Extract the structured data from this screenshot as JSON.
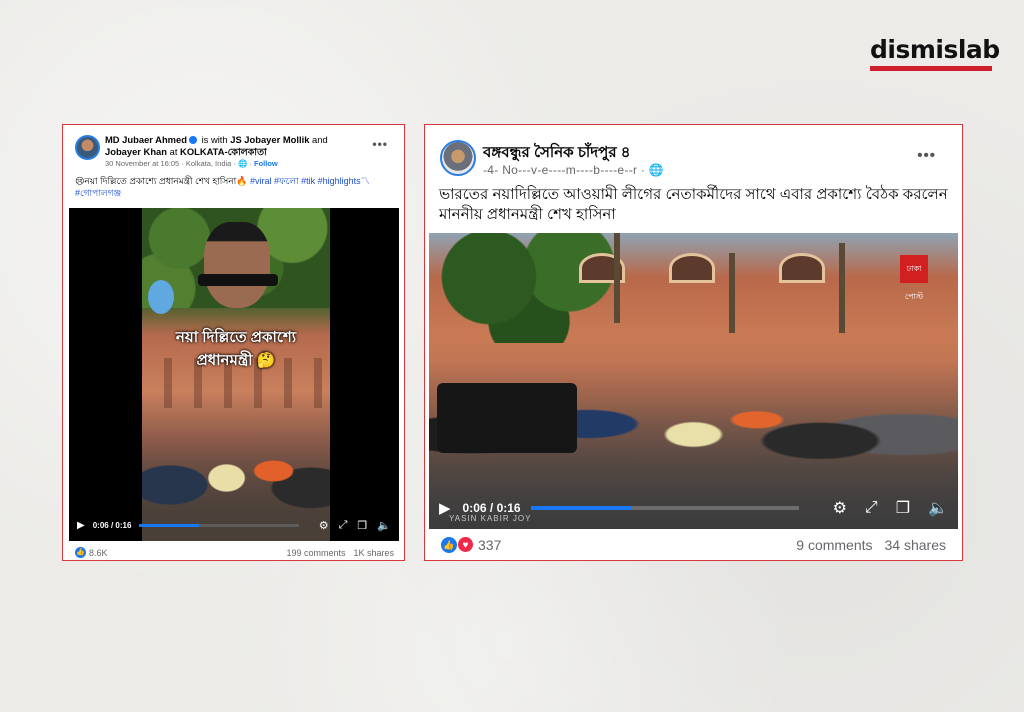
{
  "brand": {
    "name": "dismislab",
    "accent": "#d0202e"
  },
  "post1": {
    "author": "MD Jubaer Ahmed",
    "with_prefix": "is with",
    "tagged1": "JS Jobayer Mollik",
    "and_word": "and",
    "tagged2": "Jobayer Khan",
    "at_word": "at",
    "location": "KOLKATA-কোলকাতা",
    "meta": "30 November at 16:05 · Kolkata, India ·",
    "follow": "Follow",
    "caption_text": "😢নয়া দিল্লিতে প্রকাশ্যে প্রধানমন্ত্রী শেখ হাসিনা🔥",
    "tags": [
      "#viral",
      "#ফলো",
      "#tik",
      "#highlights〽",
      "#গোপালগঞ্জ"
    ],
    "overlay_line1": "নয়া দিল্লিতে প্রকাশ্যে",
    "overlay_line2": "প্রধানমন্ত্রী 🤔",
    "video_time": "0:06 / 0:16",
    "progress": 0.375,
    "reactions": "8.6K",
    "comments": "199 comments",
    "shares": "1K shares",
    "icons": [
      "more-icon",
      "globe-icon",
      "play-icon",
      "settings-icon",
      "fullscreen-icon",
      "pip-icon",
      "volume-icon",
      "like-icon"
    ]
  },
  "post2": {
    "page_name": "বঙ্গবন্ধুর সৈনিক চাঁদপুর ৪",
    "meta": "-4- No---v-e----m----b----e--r ·",
    "caption": "ভারতের নয়াদিল্লিতে আওয়ামী লীগের নেতাকর্মীদের সাথে এবার প্রকাশ্যে বৈঠক করলেন মাননীয় প্রধানমন্ত্রী শেখ হাসিনা",
    "video_time": "0:06 / 0:16",
    "progress": 0.375,
    "watermark": "YASIN KABIR JOY",
    "channel_logo": "ঢাকা পোস্ট",
    "reactions": "337",
    "comments": "9 comments",
    "shares": "34 shares",
    "icons": [
      "more-icon",
      "globe-icon",
      "play-icon",
      "settings-icon",
      "fullscreen-icon",
      "pip-icon",
      "volume-icon",
      "like-icon",
      "heart-icon"
    ]
  }
}
